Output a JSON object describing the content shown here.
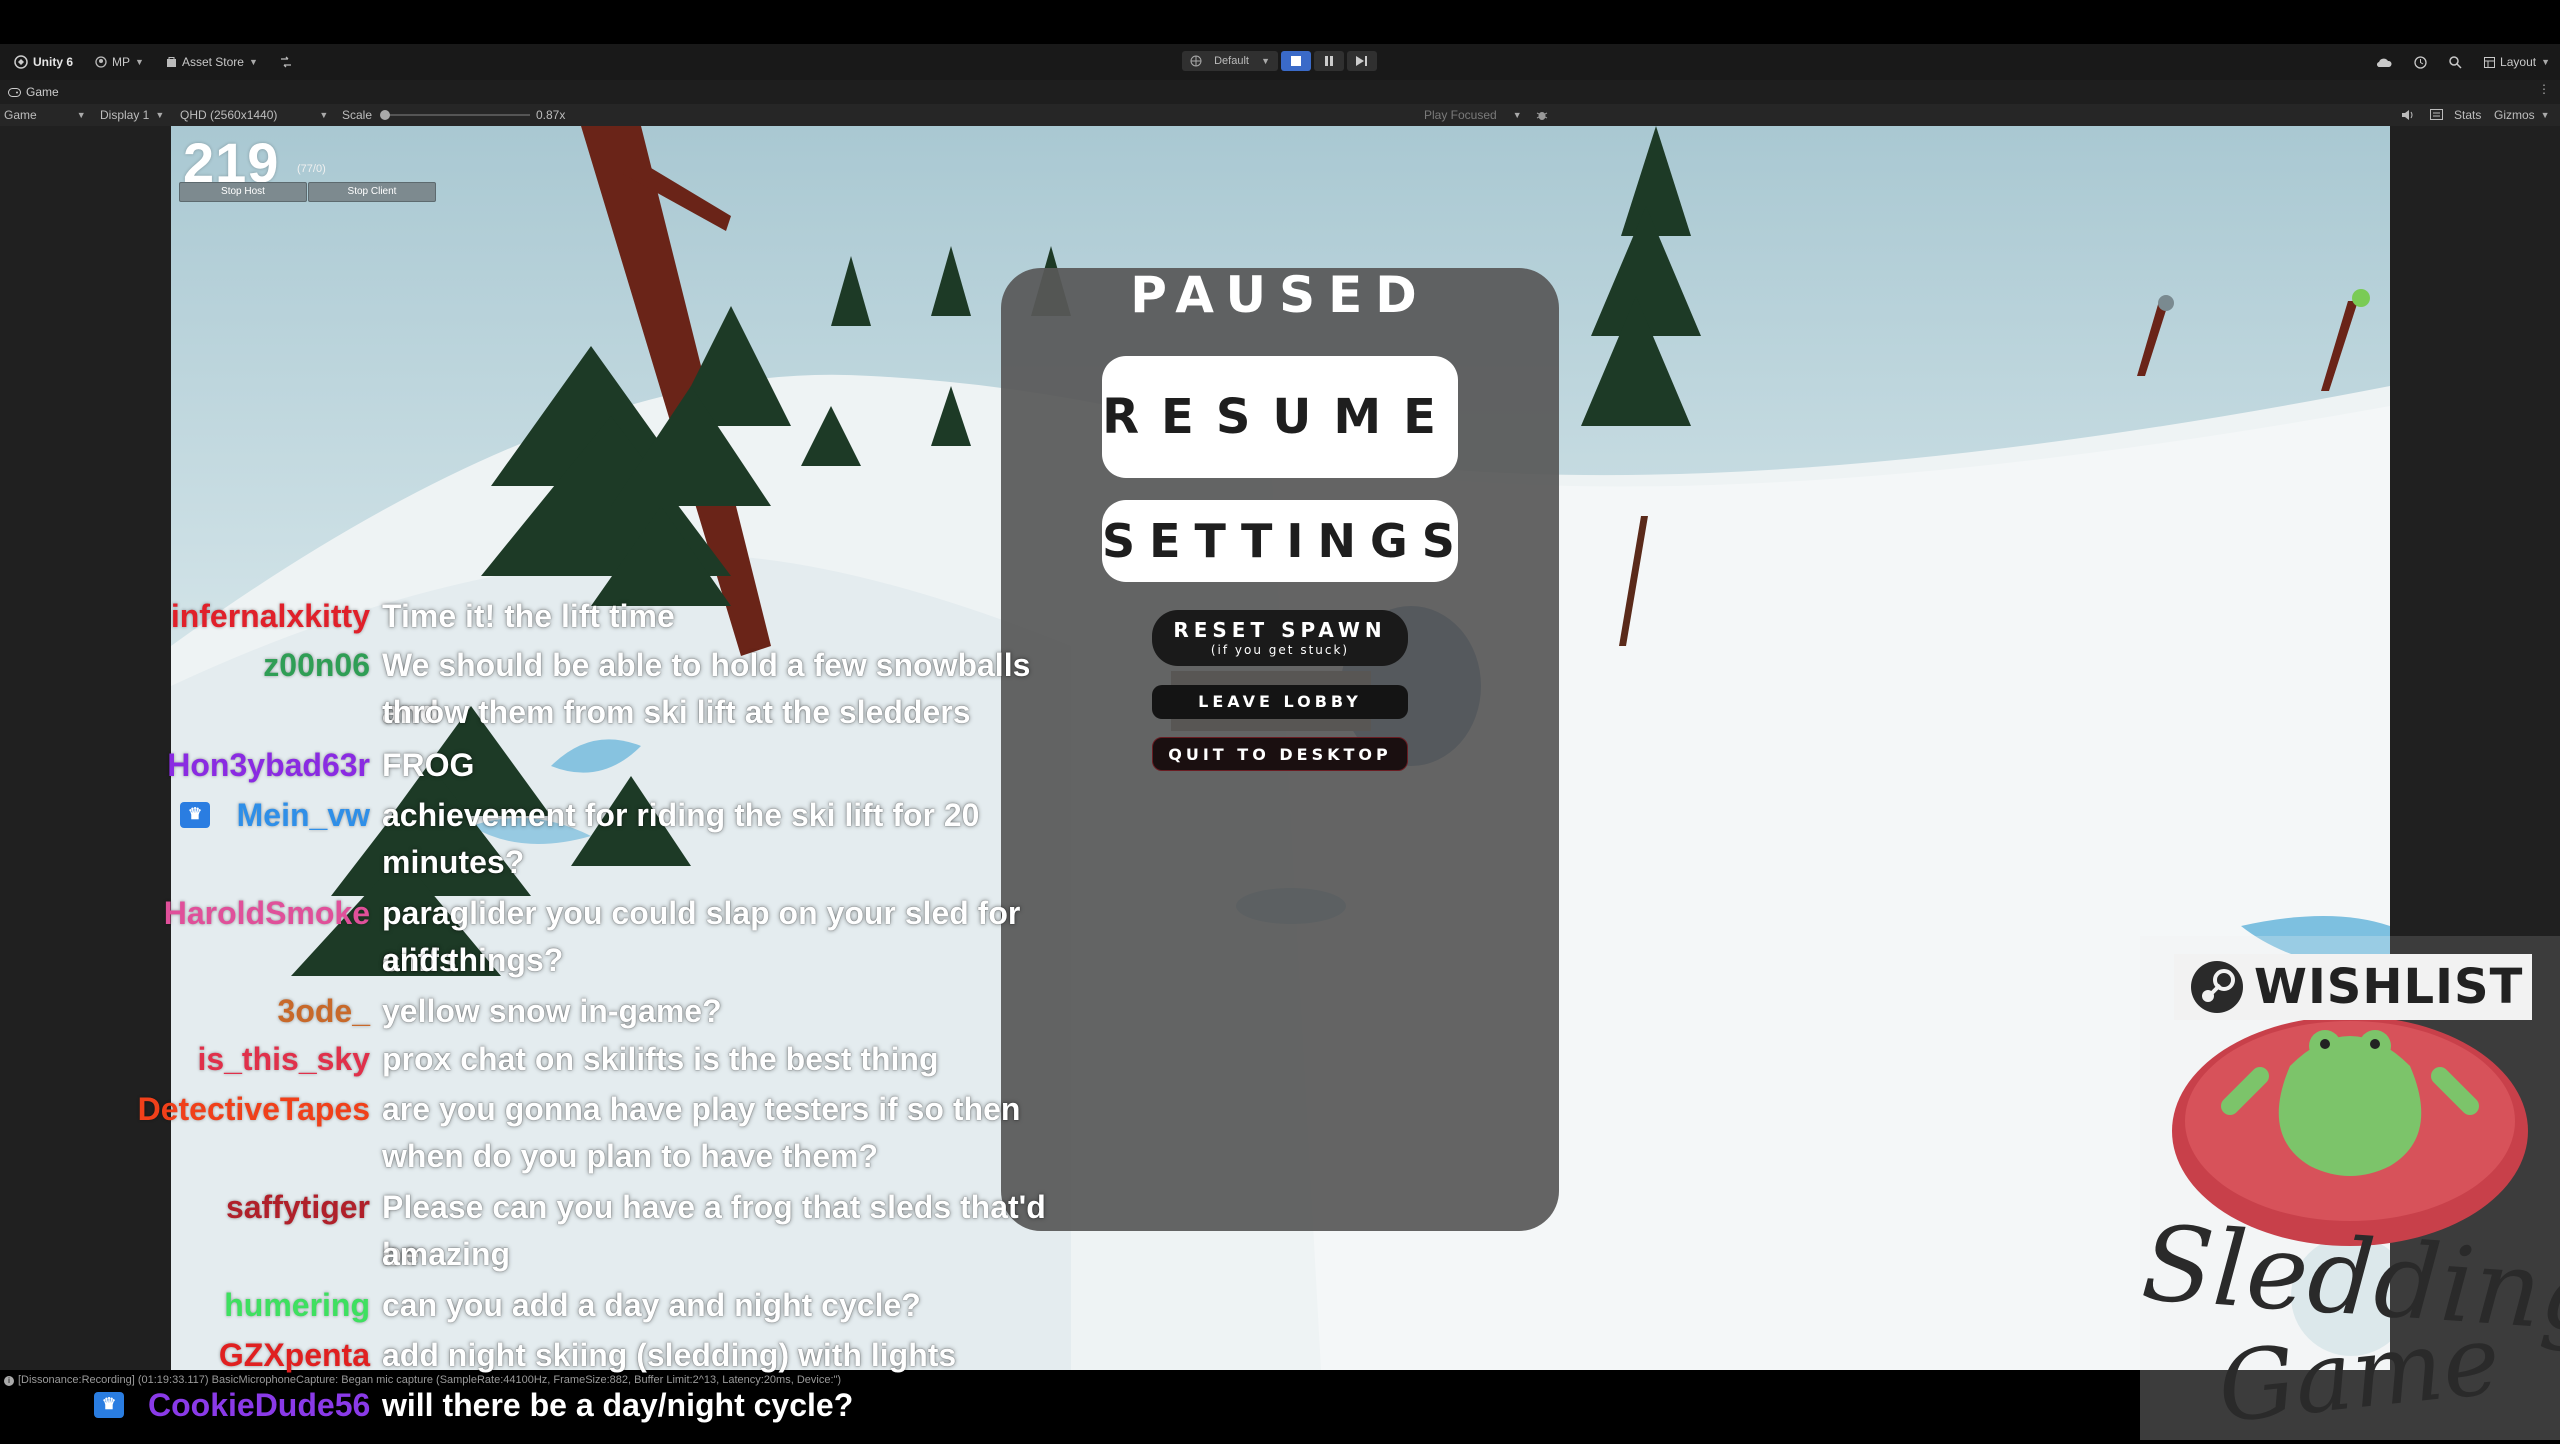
{
  "editor": {
    "unity_label": "Unity 6",
    "account_label": "MP",
    "asset_store_label": "Asset Store",
    "playmode_profile": "Default",
    "layout_label": "Layout",
    "game_tab_label": "Game",
    "game_dropdown": "Game",
    "display_dropdown": "Display 1",
    "resolution_dropdown": "QHD (2560x1440)",
    "scale_label": "Scale",
    "scale_value": "0.87x",
    "play_focused_label": "Play Focused",
    "stats_label": "Stats",
    "gizmos_label": "Gizmos",
    "console_line": "[Dissonance:Recording] (01:19:33.117) BasicMicrophoneCapture: Began mic capture (SampleRate:44100Hz, FrameSize:882, Buffer Limit:2^13, Latency:20ms, Device:\")"
  },
  "hud": {
    "fps_value": "219",
    "fps_small": "(77/0)",
    "stop_host_label": "Stop Host",
    "stop_client_label": "Stop Client"
  },
  "pause_menu": {
    "title": "PAUSED",
    "resume_label": "RESUME",
    "settings_label": "SETTINGS",
    "reset_spawn_label": "RESET SPAWN",
    "reset_spawn_sub": "(if you get stuck)",
    "leave_lobby_label": "LEAVE LOBBY",
    "quit_label": "QUIT TO DESKTOP"
  },
  "chat": {
    "messages": [
      {
        "user": "infernalxkitty",
        "color": "#e0202a",
        "lines": [
          "Time it! the lift time"
        ]
      },
      {
        "user": "z00n06",
        "color": "#2f9e55",
        "lines": [
          "We should be able to hold a few snowballs and",
          "throw them from ski lift at the sledders"
        ]
      },
      {
        "user": "Hon3ybad63r",
        "color": "#8a2be2",
        "lines": [
          "FROG"
        ]
      },
      {
        "user": "Mein_vw",
        "color": "#2f8fe8",
        "lines": [
          "achievement for riding the ski lift for 20",
          "minutes?"
        ]
      },
      {
        "user": "HaroldSmoke",
        "color": "#e0509a",
        "lines": [
          "paraglider you could slap on your sled for cliffs",
          "and things?"
        ]
      },
      {
        "user": "3ode_",
        "color": "#c8692a",
        "lines": [
          "yellow snow in-game?"
        ]
      },
      {
        "user": "is_this_sky",
        "color": "#e0304a",
        "lines": [
          "prox chat on skilifts is the best thing"
        ]
      },
      {
        "user": "DetectiveTapes",
        "color": "#f0401a",
        "lines": [
          "are you gonna have play testers if so then",
          "when do you plan to have them?"
        ]
      },
      {
        "user": "saffytiger",
        "color": "#b0202a",
        "lines": [
          "Please can you have a frog that sleds that'd be",
          "amazing"
        ]
      },
      {
        "user": "humering",
        "color": "#3ee060",
        "lines": [
          "can you add a day and night cycle?"
        ]
      },
      {
        "user": "GZXpenta",
        "color": "#e02020",
        "lines": [
          "add night skiing (sledding) with lights"
        ]
      },
      {
        "user": "CookieDude56",
        "color": "#8a3ae8",
        "lines": [
          "will there be a day/night cycle?"
        ]
      }
    ]
  },
  "promo": {
    "wishlist_label": "WISHLIST",
    "logo_line1": "Sledding",
    "logo_line2": "Game"
  }
}
